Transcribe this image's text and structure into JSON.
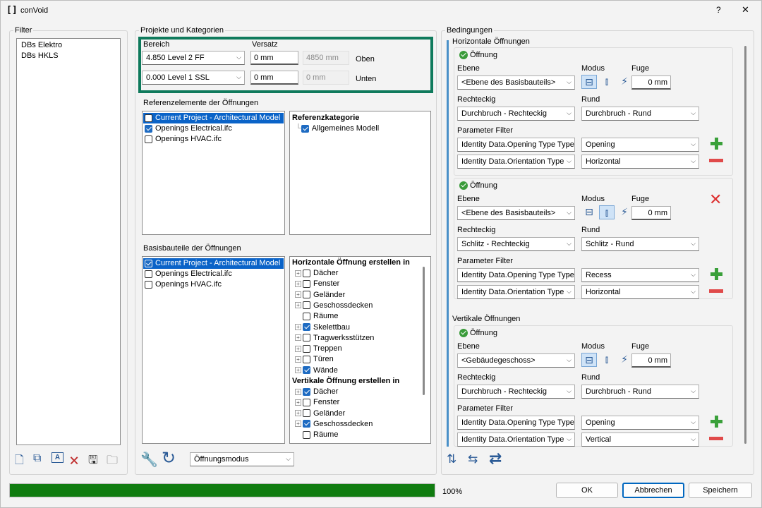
{
  "window": {
    "app_icon": "bracket-logo",
    "title": "conVoid",
    "help": "?",
    "close": "✕"
  },
  "filter": {
    "title": "Filter",
    "items": [
      "DBs Elektro",
      "DBs HKLS"
    ]
  },
  "projects": {
    "title": "Projekte und Kategorien",
    "bereich_label": "Bereich",
    "versatz_label": "Versatz",
    "rows": [
      {
        "level": "4.850  Level 2 FF",
        "offset": "0 mm",
        "computed": "4850 mm",
        "pos": "Oben"
      },
      {
        "level": "0.000  Level 1 SSL",
        "offset": "0 mm",
        "computed": "0 mm",
        "pos": "Unten"
      }
    ]
  },
  "ref": {
    "title": "Referenzelemente der Öffnungen",
    "items": [
      {
        "label": "Current Project - Architectural Model",
        "checked": false,
        "selected": true
      },
      {
        "label": "Openings Electrical.ifc",
        "checked": true
      },
      {
        "label": "Openings HVAC.ifc",
        "checked": false
      }
    ],
    "category_title": "Referenzkategorie",
    "category_item": "Allgemeines Modell"
  },
  "base": {
    "title": "Basisbauteile der Öffnungen",
    "items": [
      {
        "label": "Current Project - Architectural Model",
        "checked": true,
        "selected": true
      },
      {
        "label": "Openings Electrical.ifc",
        "checked": false
      },
      {
        "label": "Openings HVAC.ifc",
        "checked": false
      }
    ],
    "horiz_title": "Horizontale Öffnung erstellen in",
    "horiz_items": [
      {
        "label": "Dächer",
        "c": false,
        "exp": true
      },
      {
        "label": "Fenster",
        "c": false,
        "exp": true
      },
      {
        "label": "Geländer",
        "c": false,
        "exp": true
      },
      {
        "label": "Geschossdecken",
        "c": false,
        "exp": true
      },
      {
        "label": "Räume",
        "c": false,
        "exp": false
      },
      {
        "label": "Skelettbau",
        "c": true,
        "exp": true
      },
      {
        "label": "Tragwerksstützen",
        "c": false,
        "exp": true
      },
      {
        "label": "Treppen",
        "c": false,
        "exp": true
      },
      {
        "label": "Türen",
        "c": false,
        "exp": true
      },
      {
        "label": "Wände",
        "c": true,
        "exp": true
      }
    ],
    "vert_title": "Vertikale Öffnung erstellen in",
    "vert_items": [
      {
        "label": "Dächer",
        "c": true,
        "exp": true
      },
      {
        "label": "Fenster",
        "c": false,
        "exp": true
      },
      {
        "label": "Geländer",
        "c": false,
        "exp": true
      },
      {
        "label": "Geschossdecken",
        "c": true,
        "exp": true
      },
      {
        "label": "Räume",
        "c": false,
        "exp": false
      }
    ]
  },
  "mode_select": "Öffnungsmodus",
  "cond": {
    "title": "Bedingungen",
    "horiz_title": "Horizontale Öffnungen",
    "vert_title": "Vertikale Öffnungen",
    "labels": {
      "opening": "Öffnung",
      "ebene": "Ebene",
      "modus": "Modus",
      "fuge": "Fuge",
      "eckig": "Rechteckig",
      "rund": "Rund",
      "pfilter": "Parameter Filter"
    },
    "blocks": [
      {
        "ebene": "<Ebene des Basisbauteils>",
        "fuge": "0 mm",
        "eckig": "Durchbruch - Rechteckig",
        "rund": "Durchbruch - Rund",
        "p1": "Identity Data.Opening Type Type",
        "v1": "Opening",
        "p2": "Identity Data.Orientation Type",
        "v2": "Horizontal"
      },
      {
        "ebene": "<Ebene des Basisbauteils>",
        "fuge": "0 mm",
        "eckig": "Schlitz - Rechteckig",
        "rund": "Schlitz - Rund",
        "p1": "Identity Data.Opening Type Type",
        "v1": "Recess",
        "p2": "Identity Data.Orientation Type",
        "v2": "Horizontal"
      },
      {
        "ebene": "<Gebäudegeschoss>",
        "fuge": "0 mm",
        "eckig": "Durchbruch - Rechteckig",
        "rund": "Durchbruch - Rund",
        "p1": "Identity Data.Opening Type Type",
        "v1": "Opening",
        "p2": "Identity Data.Orientation Type",
        "v2": "Vertical"
      }
    ]
  },
  "progress": {
    "value": 1.0,
    "label": "100%",
    "color": "#107c10"
  },
  "buttons": {
    "ok": "OK",
    "cancel": "Abbrechen",
    "save": "Speichern"
  }
}
